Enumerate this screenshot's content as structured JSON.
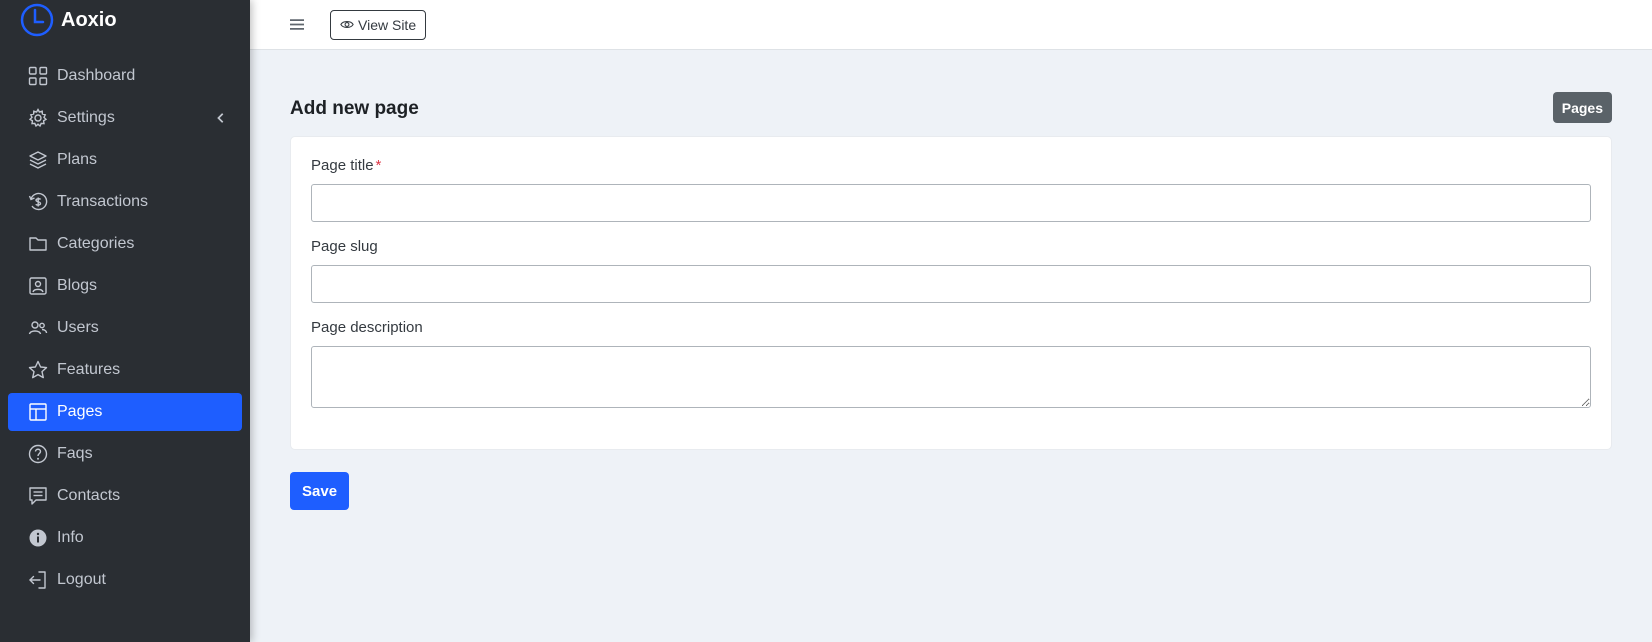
{
  "app": {
    "brand_name": "Aoxio",
    "accent_color": "#1e5eff",
    "sidebar_color": "#2a2e33"
  },
  "sidebar": {
    "items": [
      {
        "label": "Dashboard",
        "icon": "grid-icon"
      },
      {
        "label": "Settings",
        "icon": "gear-icon",
        "has_submenu": true
      },
      {
        "label": "Plans",
        "icon": "layers-icon"
      },
      {
        "label": "Transactions",
        "icon": "currency-icon"
      },
      {
        "label": "Categories",
        "icon": "folder-icon"
      },
      {
        "label": "Blogs",
        "icon": "image-icon"
      },
      {
        "label": "Users",
        "icon": "users-icon"
      },
      {
        "label": "Features",
        "icon": "star-icon"
      },
      {
        "label": "Pages",
        "icon": "layout-icon",
        "active": true
      },
      {
        "label": "Faqs",
        "icon": "question-icon"
      },
      {
        "label": "Contacts",
        "icon": "message-icon"
      },
      {
        "label": "Info",
        "icon": "info-icon"
      },
      {
        "label": "Logout",
        "icon": "logout-icon"
      }
    ]
  },
  "topbar": {
    "view_site_label": "View Site"
  },
  "main": {
    "heading": "Add new page",
    "breadcrumb_badge": "Pages",
    "form": {
      "title_label": "Page title",
      "title_required_mark": "*",
      "title_value": "",
      "slug_label": "Page slug",
      "slug_value": "",
      "description_label": "Page description",
      "description_value": ""
    },
    "save_label": "Save"
  }
}
